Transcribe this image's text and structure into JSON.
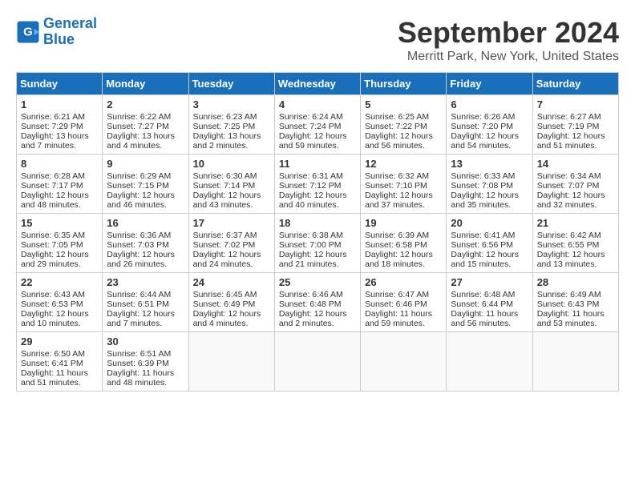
{
  "header": {
    "logo_line1": "General",
    "logo_line2": "Blue",
    "month": "September 2024",
    "location": "Merritt Park, New York, United States"
  },
  "days_of_week": [
    "Sunday",
    "Monday",
    "Tuesday",
    "Wednesday",
    "Thursday",
    "Friday",
    "Saturday"
  ],
  "weeks": [
    [
      {
        "day": 1,
        "lines": [
          "Sunrise: 6:21 AM",
          "Sunset: 7:29 PM",
          "Daylight: 13 hours",
          "and 7 minutes."
        ]
      },
      {
        "day": 2,
        "lines": [
          "Sunrise: 6:22 AM",
          "Sunset: 7:27 PM",
          "Daylight: 13 hours",
          "and 4 minutes."
        ]
      },
      {
        "day": 3,
        "lines": [
          "Sunrise: 6:23 AM",
          "Sunset: 7:25 PM",
          "Daylight: 13 hours",
          "and 2 minutes."
        ]
      },
      {
        "day": 4,
        "lines": [
          "Sunrise: 6:24 AM",
          "Sunset: 7:24 PM",
          "Daylight: 12 hours",
          "and 59 minutes."
        ]
      },
      {
        "day": 5,
        "lines": [
          "Sunrise: 6:25 AM",
          "Sunset: 7:22 PM",
          "Daylight: 12 hours",
          "and 56 minutes."
        ]
      },
      {
        "day": 6,
        "lines": [
          "Sunrise: 6:26 AM",
          "Sunset: 7:20 PM",
          "Daylight: 12 hours",
          "and 54 minutes."
        ]
      },
      {
        "day": 7,
        "lines": [
          "Sunrise: 6:27 AM",
          "Sunset: 7:19 PM",
          "Daylight: 12 hours",
          "and 51 minutes."
        ]
      }
    ],
    [
      {
        "day": 8,
        "lines": [
          "Sunrise: 6:28 AM",
          "Sunset: 7:17 PM",
          "Daylight: 12 hours",
          "and 48 minutes."
        ]
      },
      {
        "day": 9,
        "lines": [
          "Sunrise: 6:29 AM",
          "Sunset: 7:15 PM",
          "Daylight: 12 hours",
          "and 46 minutes."
        ]
      },
      {
        "day": 10,
        "lines": [
          "Sunrise: 6:30 AM",
          "Sunset: 7:14 PM",
          "Daylight: 12 hours",
          "and 43 minutes."
        ]
      },
      {
        "day": 11,
        "lines": [
          "Sunrise: 6:31 AM",
          "Sunset: 7:12 PM",
          "Daylight: 12 hours",
          "and 40 minutes."
        ]
      },
      {
        "day": 12,
        "lines": [
          "Sunrise: 6:32 AM",
          "Sunset: 7:10 PM",
          "Daylight: 12 hours",
          "and 37 minutes."
        ]
      },
      {
        "day": 13,
        "lines": [
          "Sunrise: 6:33 AM",
          "Sunset: 7:08 PM",
          "Daylight: 12 hours",
          "and 35 minutes."
        ]
      },
      {
        "day": 14,
        "lines": [
          "Sunrise: 6:34 AM",
          "Sunset: 7:07 PM",
          "Daylight: 12 hours",
          "and 32 minutes."
        ]
      }
    ],
    [
      {
        "day": 15,
        "lines": [
          "Sunrise: 6:35 AM",
          "Sunset: 7:05 PM",
          "Daylight: 12 hours",
          "and 29 minutes."
        ]
      },
      {
        "day": 16,
        "lines": [
          "Sunrise: 6:36 AM",
          "Sunset: 7:03 PM",
          "Daylight: 12 hours",
          "and 26 minutes."
        ]
      },
      {
        "day": 17,
        "lines": [
          "Sunrise: 6:37 AM",
          "Sunset: 7:02 PM",
          "Daylight: 12 hours",
          "and 24 minutes."
        ]
      },
      {
        "day": 18,
        "lines": [
          "Sunrise: 6:38 AM",
          "Sunset: 7:00 PM",
          "Daylight: 12 hours",
          "and 21 minutes."
        ]
      },
      {
        "day": 19,
        "lines": [
          "Sunrise: 6:39 AM",
          "Sunset: 6:58 PM",
          "Daylight: 12 hours",
          "and 18 minutes."
        ]
      },
      {
        "day": 20,
        "lines": [
          "Sunrise: 6:41 AM",
          "Sunset: 6:56 PM",
          "Daylight: 12 hours",
          "and 15 minutes."
        ]
      },
      {
        "day": 21,
        "lines": [
          "Sunrise: 6:42 AM",
          "Sunset: 6:55 PM",
          "Daylight: 12 hours",
          "and 13 minutes."
        ]
      }
    ],
    [
      {
        "day": 22,
        "lines": [
          "Sunrise: 6:43 AM",
          "Sunset: 6:53 PM",
          "Daylight: 12 hours",
          "and 10 minutes."
        ]
      },
      {
        "day": 23,
        "lines": [
          "Sunrise: 6:44 AM",
          "Sunset: 6:51 PM",
          "Daylight: 12 hours",
          "and 7 minutes."
        ]
      },
      {
        "day": 24,
        "lines": [
          "Sunrise: 6:45 AM",
          "Sunset: 6:49 PM",
          "Daylight: 12 hours",
          "and 4 minutes."
        ]
      },
      {
        "day": 25,
        "lines": [
          "Sunrise: 6:46 AM",
          "Sunset: 6:48 PM",
          "Daylight: 12 hours",
          "and 2 minutes."
        ]
      },
      {
        "day": 26,
        "lines": [
          "Sunrise: 6:47 AM",
          "Sunset: 6:46 PM",
          "Daylight: 11 hours",
          "and 59 minutes."
        ]
      },
      {
        "day": 27,
        "lines": [
          "Sunrise: 6:48 AM",
          "Sunset: 6:44 PM",
          "Daylight: 11 hours",
          "and 56 minutes."
        ]
      },
      {
        "day": 28,
        "lines": [
          "Sunrise: 6:49 AM",
          "Sunset: 6:43 PM",
          "Daylight: 11 hours",
          "and 53 minutes."
        ]
      }
    ],
    [
      {
        "day": 29,
        "lines": [
          "Sunrise: 6:50 AM",
          "Sunset: 6:41 PM",
          "Daylight: 11 hours",
          "and 51 minutes."
        ]
      },
      {
        "day": 30,
        "lines": [
          "Sunrise: 6:51 AM",
          "Sunset: 6:39 PM",
          "Daylight: 11 hours",
          "and 48 minutes."
        ]
      },
      null,
      null,
      null,
      null,
      null
    ]
  ]
}
